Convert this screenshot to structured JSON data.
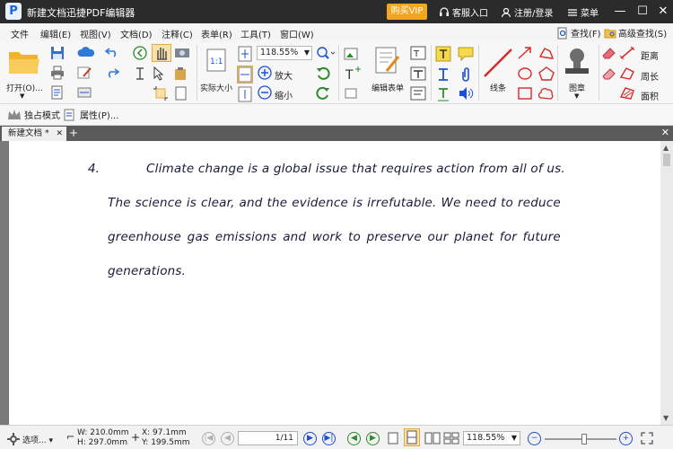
{
  "app": {
    "title": "新建文档迅捷PDF编辑器",
    "logo_letter": "P",
    "vip_label": "购买VIP",
    "support_label": "客服入口",
    "login_label": "注册/登录",
    "menu_label": "菜单"
  },
  "menubar": {
    "items": [
      "文件",
      "编辑(E)",
      "视图(V)",
      "文档(D)",
      "注释(C)",
      "表单(R)",
      "工具(T)",
      "窗口(W)"
    ],
    "find_label": "查找(F)",
    "adv_find_label": "高级查找(S)"
  },
  "ribbon": {
    "open_label": "打开(O)...",
    "actual_size_label": "实际大小",
    "zoom_value": "118.55%",
    "zoom_in_label": "放大",
    "zoom_out_label": "缩小",
    "edit_form_label": "编辑表单",
    "line_label": "线条",
    "stamp_label": "图章",
    "distance_label": "距离",
    "perimeter_label": "周长",
    "area_label": "面积"
  },
  "subbar": {
    "exclusive_mode_label": "独占模式",
    "properties_label": "属性(P)..."
  },
  "tabs": [
    {
      "label": "新建文档 *"
    }
  ],
  "document": {
    "paragraph_number": "4.",
    "lines": [
      "Climate change is a global issue that requires action from all of us.",
      "The science is clear, and the evidence is irrefutable. We need to reduce",
      "greenhouse gas emissions and work to preserve our planet for future",
      "generations."
    ]
  },
  "status": {
    "options_label": "选项...",
    "width": "W: 210.0mm",
    "height": "H: 297.0mm",
    "x": "X:   97.1mm",
    "y": "Y: 199.5mm",
    "page_display": "1/11",
    "zoom": "118.55%",
    "zoom_slider_fraction": 0.55
  },
  "colors": {
    "titlebar": "#2b2b2b",
    "vip": "#f0a61e",
    "nav_green": "#2d8a2d",
    "nav_blue": "#1b4fd6"
  }
}
